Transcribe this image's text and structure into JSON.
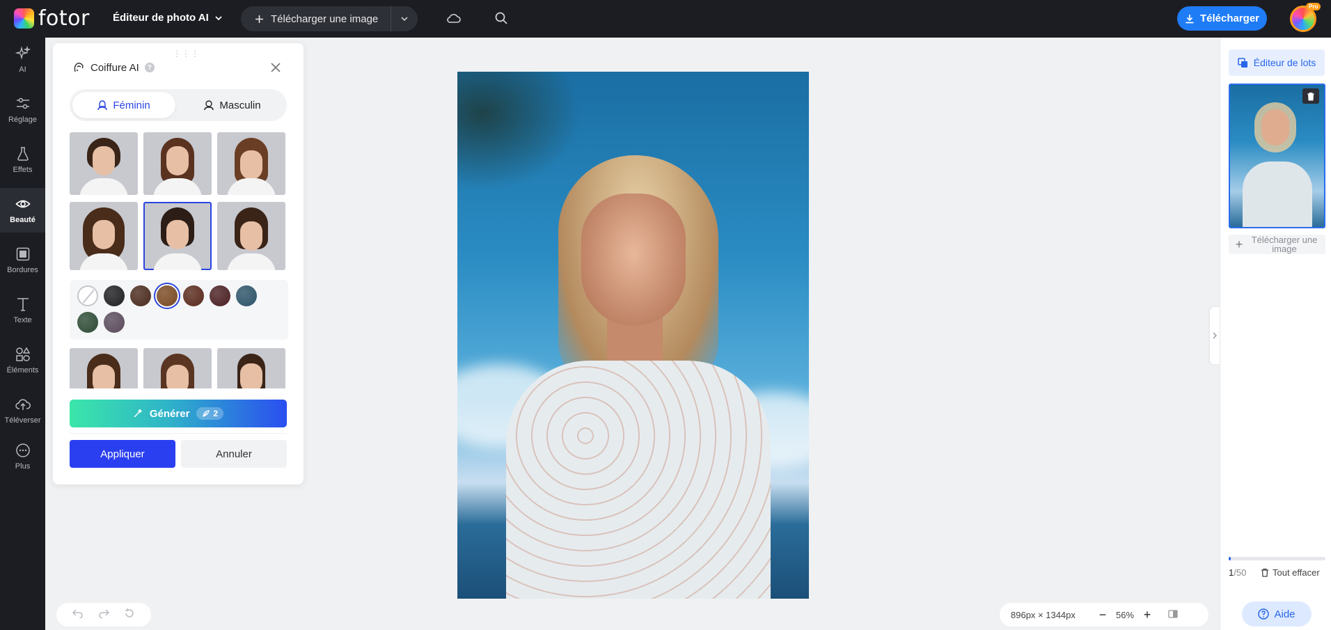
{
  "app": {
    "logo_text": "fotor",
    "editor_menu_label": "Éditeur de photo AI",
    "upload_label": "Télécharger une image",
    "download_label": "Télécharger",
    "pro_badge": "Pro"
  },
  "rail": {
    "items": [
      {
        "label": "AI",
        "icon": "sparkle-icon"
      },
      {
        "label": "Réglage",
        "icon": "sliders-icon"
      },
      {
        "label": "Effets",
        "icon": "flask-icon"
      },
      {
        "label": "Beauté",
        "icon": "eye-icon"
      },
      {
        "label": "Bordures",
        "icon": "frame-icon"
      },
      {
        "label": "Texte",
        "icon": "text-icon"
      },
      {
        "label": "Éléments",
        "icon": "shapes-icon"
      },
      {
        "label": "Téléverser",
        "icon": "upload-cloud-icon"
      },
      {
        "label": "Plus",
        "icon": "more-icon"
      }
    ],
    "active_index": 3
  },
  "panel": {
    "title": "Coiffure AI",
    "help_glyph": "?",
    "gender": {
      "female_label": "Féminin",
      "male_label": "Masculin",
      "selected": "female"
    },
    "selected_style_index": 4,
    "selected_color_index": 3,
    "hair_colors": [
      "#1f1f22",
      "#4a2a1c",
      "#7a4a22",
      "#5a2a1c",
      "#4a1f22",
      "#2c5368",
      "#2d4a35",
      "#5a4a5a"
    ],
    "generate_label": "Générer",
    "generate_credits": "2",
    "apply_label": "Appliquer",
    "cancel_label": "Annuler"
  },
  "right_panel": {
    "batch_label": "Éditeur de lots",
    "upload_more_label": "Télécharger une image",
    "count_current": "1",
    "count_total": "/50",
    "progress_fraction": 0.02,
    "clear_label": "Tout effacer"
  },
  "bottom": {
    "dimensions": "896px × 1344px",
    "zoom": "56%",
    "help_label": "Aide"
  },
  "colors": {
    "accent_blue": "#1f7cf7",
    "apply_blue": "#2a3ff0",
    "topbar_bg": "#1c1d22"
  }
}
